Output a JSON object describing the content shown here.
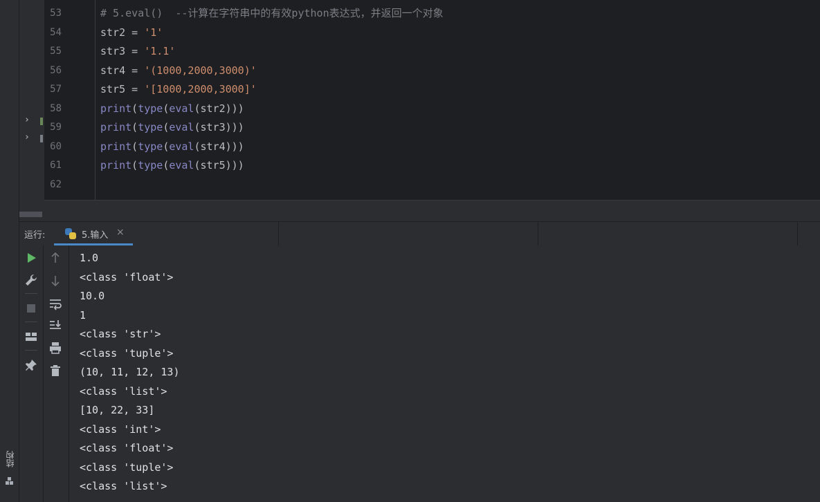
{
  "editor": {
    "lines": [
      {
        "num": "53",
        "tokens": [
          {
            "t": "# 5.eval()  --计算在字符串中的有效python表达式，并返回一个对象",
            "c": "comment"
          }
        ]
      },
      {
        "num": "54",
        "tokens": [
          {
            "t": "str2 = ",
            "c": "plain"
          },
          {
            "t": "'1'",
            "c": "val"
          }
        ]
      },
      {
        "num": "55",
        "tokens": [
          {
            "t": "str3 = ",
            "c": "plain"
          },
          {
            "t": "'1.1'",
            "c": "val"
          }
        ]
      },
      {
        "num": "56",
        "tokens": [
          {
            "t": "str4 = ",
            "c": "plain"
          },
          {
            "t": "'(1000,2000,3000)'",
            "c": "val"
          }
        ]
      },
      {
        "num": "57",
        "tokens": [
          {
            "t": "str5 = ",
            "c": "plain"
          },
          {
            "t": "'[1000,2000,3000]'",
            "c": "val"
          }
        ]
      },
      {
        "num": "58",
        "tokens": [
          {
            "t": "print",
            "c": "builtin"
          },
          {
            "t": "(",
            "c": "plain"
          },
          {
            "t": "type",
            "c": "builtin"
          },
          {
            "t": "(",
            "c": "plain"
          },
          {
            "t": "eval",
            "c": "builtin"
          },
          {
            "t": "(str2)))",
            "c": "plain"
          }
        ]
      },
      {
        "num": "59",
        "tokens": [
          {
            "t": "print",
            "c": "builtin"
          },
          {
            "t": "(",
            "c": "plain"
          },
          {
            "t": "type",
            "c": "builtin"
          },
          {
            "t": "(",
            "c": "plain"
          },
          {
            "t": "eval",
            "c": "builtin"
          },
          {
            "t": "(str3)))",
            "c": "plain"
          }
        ]
      },
      {
        "num": "60",
        "tokens": [
          {
            "t": "print",
            "c": "builtin"
          },
          {
            "t": "(",
            "c": "plain"
          },
          {
            "t": "type",
            "c": "builtin"
          },
          {
            "t": "(",
            "c": "plain"
          },
          {
            "t": "eval",
            "c": "builtin"
          },
          {
            "t": "(str4)))",
            "c": "plain"
          }
        ]
      },
      {
        "num": "61",
        "tokens": [
          {
            "t": "print",
            "c": "builtin"
          },
          {
            "t": "(",
            "c": "plain"
          },
          {
            "t": "type",
            "c": "builtin"
          },
          {
            "t": "(",
            "c": "plain"
          },
          {
            "t": "eval",
            "c": "builtin"
          },
          {
            "t": "(str5)))",
            "c": "plain"
          }
        ]
      },
      {
        "num": "62",
        "tokens": []
      }
    ]
  },
  "run": {
    "label": "运行:",
    "tab_title": "5.输入",
    "tab_close": "×",
    "output": [
      "1.0",
      "<class 'float'>",
      "10.0",
      "1",
      "<class 'str'>",
      "<class 'tuple'>",
      "(10, 11, 12, 13)",
      "<class 'list'>",
      "[10, 22, 33]",
      "<class 'int'>",
      "<class 'float'>",
      "<class 'tuple'>",
      "<class 'list'>"
    ]
  },
  "sidebar": {
    "structure_label": "结构"
  },
  "colors": {
    "comment": "#7a7e85",
    "string": "#cf8e6d",
    "builtin": "#8888c6",
    "run_green": "#5fb865",
    "accent": "#4a88c7"
  }
}
